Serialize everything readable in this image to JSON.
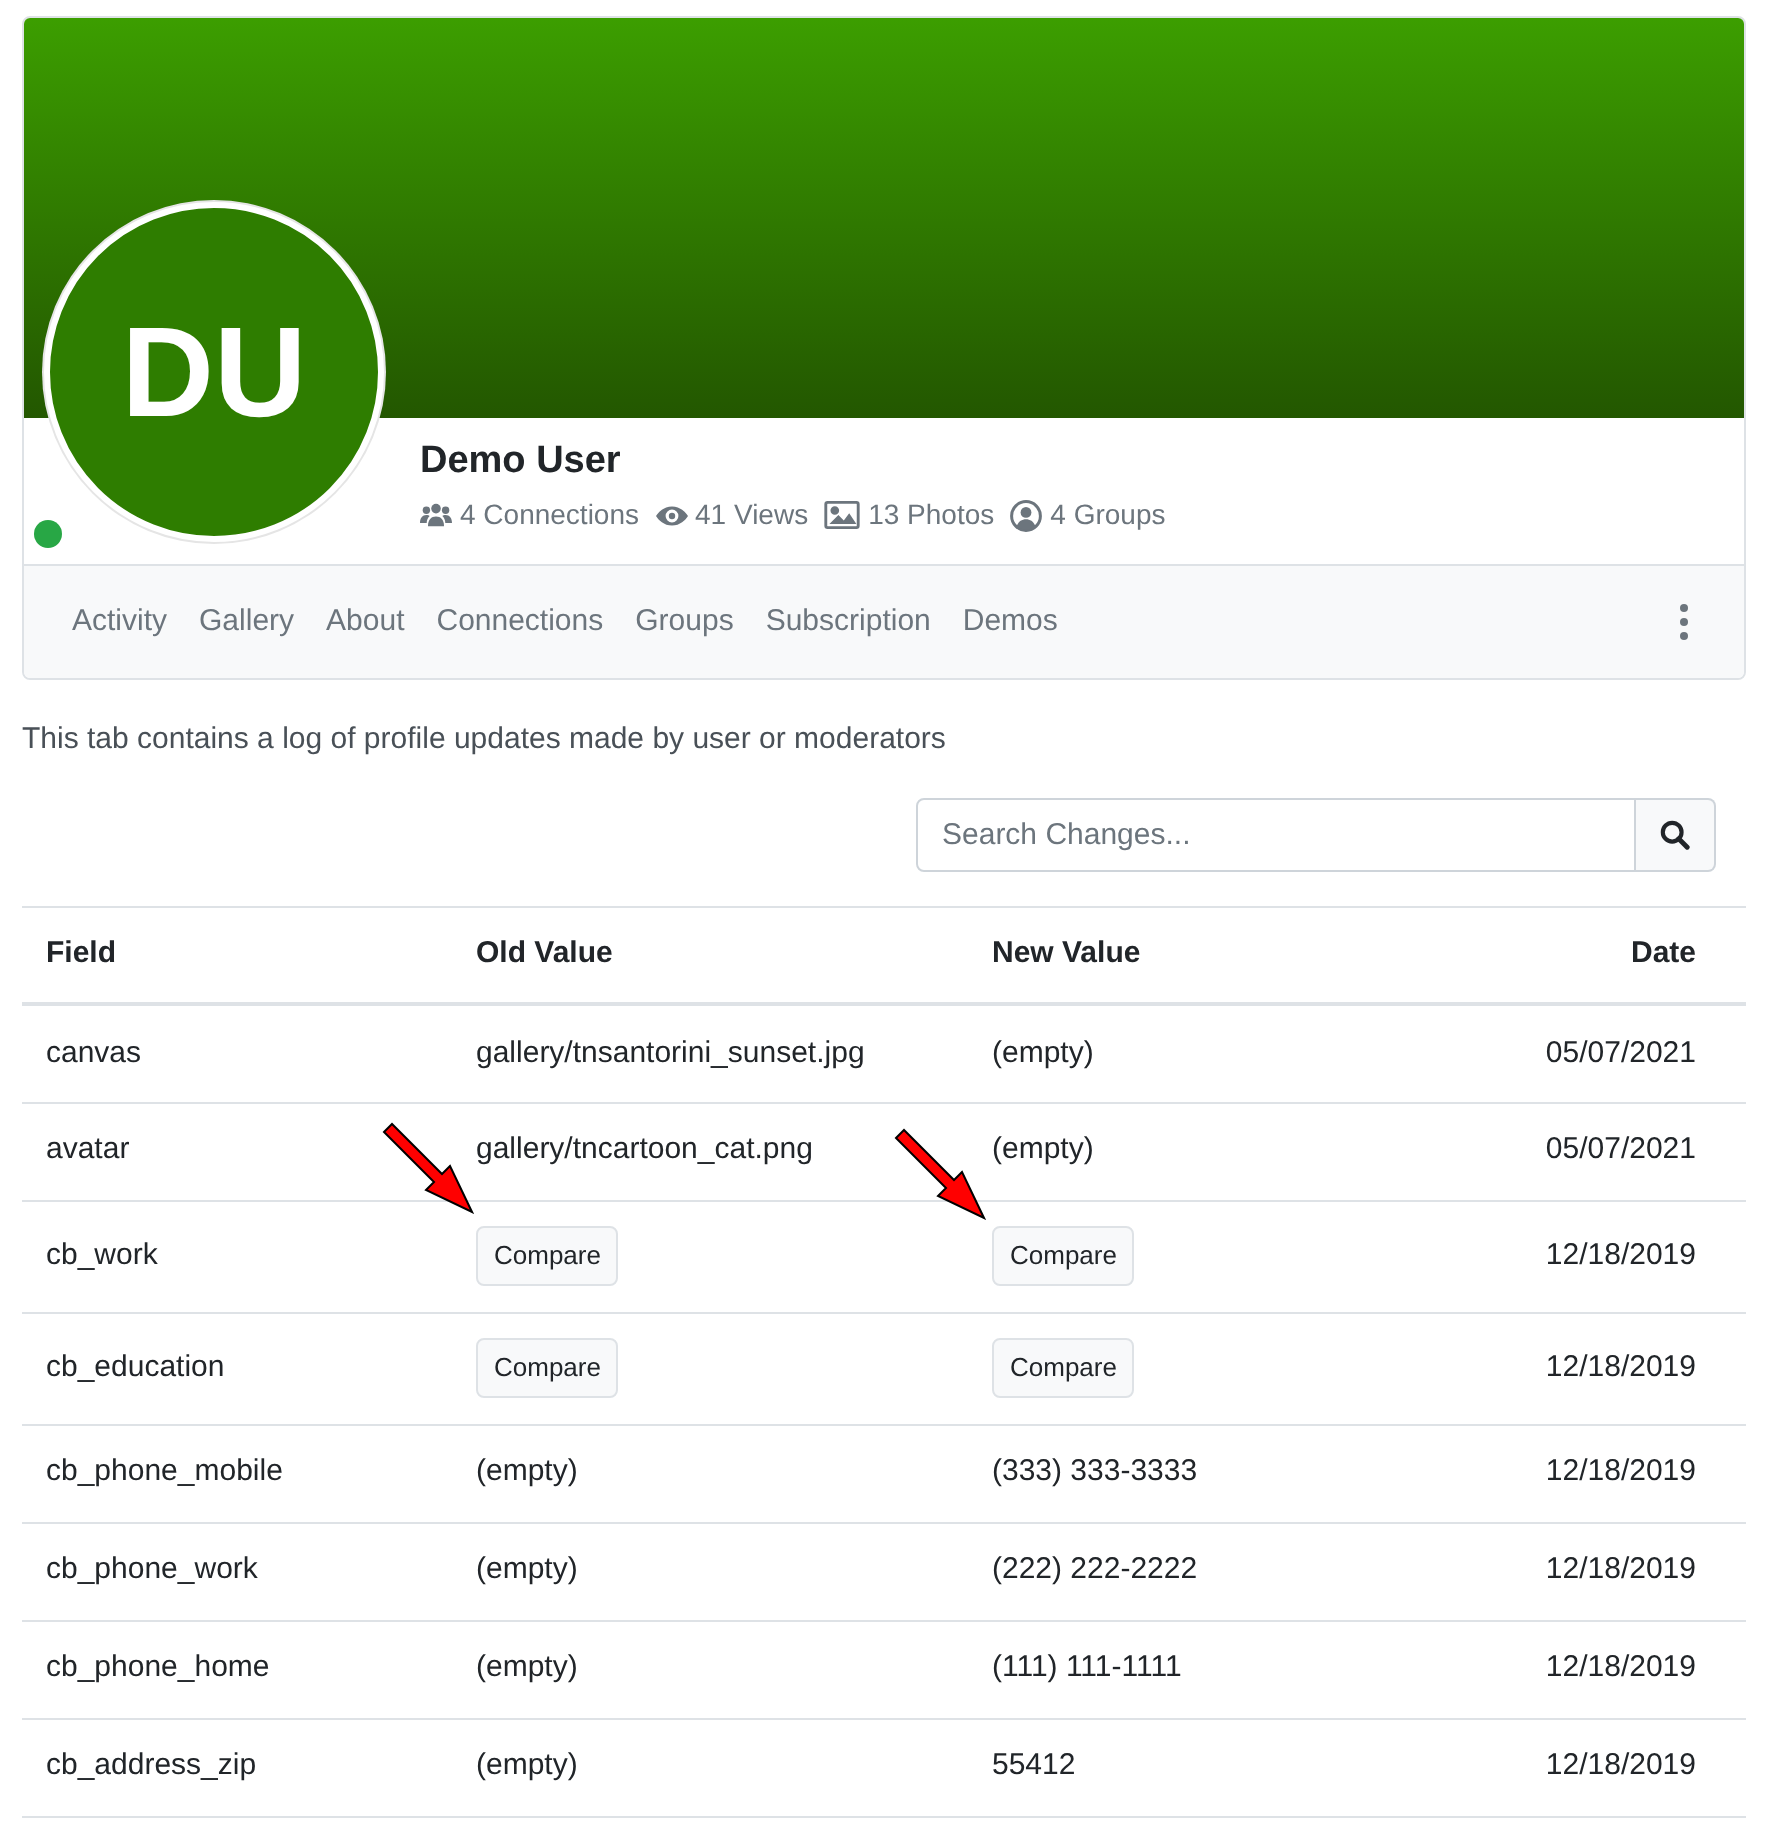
{
  "profile": {
    "initials": "DU",
    "online": true,
    "name": "Demo User",
    "stats": [
      {
        "kind": "connections",
        "text": "4 Connections"
      },
      {
        "kind": "views",
        "text": "41 Views"
      },
      {
        "kind": "photos",
        "text": "13 Photos"
      },
      {
        "kind": "groups",
        "text": "4 Groups"
      }
    ]
  },
  "tabs": [
    {
      "label": "Activity",
      "selected": false
    },
    {
      "label": "Gallery",
      "selected": false
    },
    {
      "label": "About",
      "selected": false
    },
    {
      "label": "Connections",
      "selected": false
    },
    {
      "label": "Groups",
      "selected": false
    },
    {
      "label": "Subscription",
      "selected": false
    },
    {
      "label": "Demos",
      "selected": false
    }
  ],
  "description": "This tab contains a log of profile updates made by user or moderators",
  "search": {
    "placeholder": "Search Changes..."
  },
  "table": {
    "columns": [
      "Field",
      "Old Value",
      "New Value",
      "Date"
    ],
    "rows": [
      {
        "field": "canvas",
        "old": {
          "kind": "text",
          "text": "gallery/tnsantorini_sunset.jpg"
        },
        "new": {
          "kind": "text",
          "text": "(empty)"
        },
        "date": "05/07/2021"
      },
      {
        "field": "avatar",
        "old": {
          "kind": "text",
          "text": "gallery/tncartoon_cat.png"
        },
        "new": {
          "kind": "text",
          "text": "(empty)"
        },
        "date": "05/07/2021"
      },
      {
        "field": "cb_work",
        "old": {
          "kind": "button",
          "text": "Compare"
        },
        "new": {
          "kind": "button",
          "text": "Compare"
        },
        "date": "12/18/2019"
      },
      {
        "field": "cb_education",
        "old": {
          "kind": "button",
          "text": "Compare"
        },
        "new": {
          "kind": "button",
          "text": "Compare"
        },
        "date": "12/18/2019"
      },
      {
        "field": "cb_phone_mobile",
        "old": {
          "kind": "text",
          "text": "(empty)"
        },
        "new": {
          "kind": "text",
          "text": "(333) 333-3333"
        },
        "date": "12/18/2019"
      },
      {
        "field": "cb_phone_work",
        "old": {
          "kind": "text",
          "text": "(empty)"
        },
        "new": {
          "kind": "text",
          "text": "(222) 222-2222"
        },
        "date": "12/18/2019"
      },
      {
        "field": "cb_phone_home",
        "old": {
          "kind": "text",
          "text": "(empty)"
        },
        "new": {
          "kind": "text",
          "text": "(111) 111-1111"
        },
        "date": "12/18/2019"
      },
      {
        "field": "cb_address_zip",
        "old": {
          "kind": "text",
          "text": "(empty)"
        },
        "new": {
          "kind": "text",
          "text": "55412"
        },
        "date": "12/18/2019"
      }
    ]
  }
}
